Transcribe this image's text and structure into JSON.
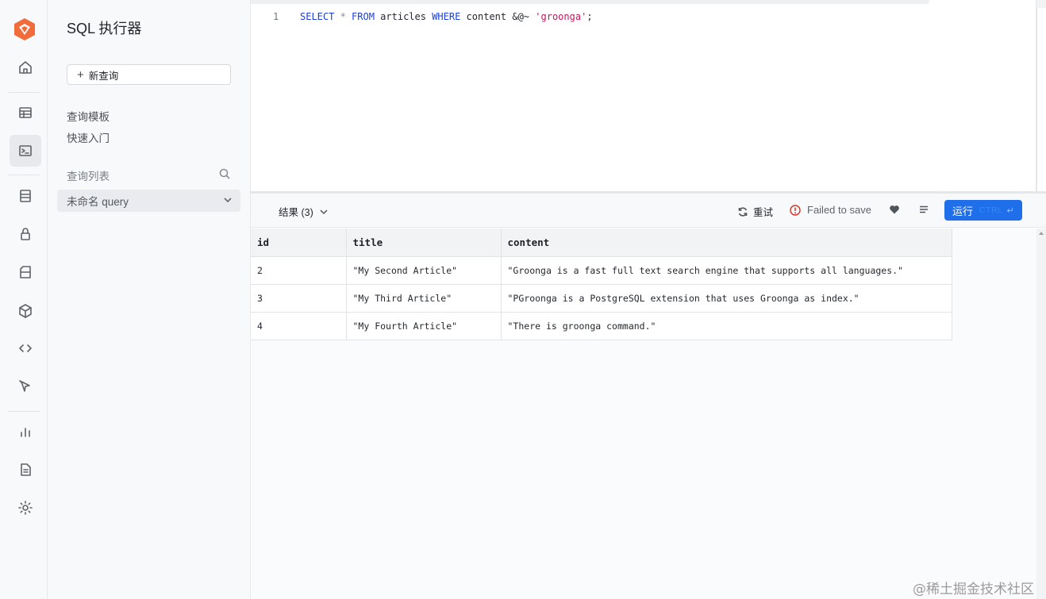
{
  "sidebar": {
    "title": "SQL 执行器",
    "new_query_label": "新查询",
    "links": [
      "查询模板",
      "快速入门"
    ],
    "query_list_label": "查询列表",
    "query_item_label": "未命名 query"
  },
  "editor": {
    "line_number": "1",
    "code_tokens": {
      "t1": "SELECT",
      "t2": " * ",
      "t3": "FROM",
      "t4": " articles ",
      "t5": "WHERE",
      "t6": " content ",
      "t7": "&@~",
      "t8": " ",
      "t9": "'groonga'",
      "t10": ";"
    }
  },
  "results": {
    "results_label": "结果 (3)",
    "retry_label": "重试",
    "status_text": "Failed to save",
    "run_label": "运行",
    "run_shortcut": "CTRL",
    "run_enter": "↵",
    "columns": [
      "id",
      "title",
      "content"
    ],
    "rows": [
      [
        "2",
        "\"My Second Article\"",
        "\"Groonga is a fast full text search engine that supports all languages.\""
      ],
      [
        "3",
        "\"My Third Article\"",
        "\"PGroonga is a PostgreSQL extension that uses Groonga as index.\""
      ],
      [
        "4",
        "\"My Fourth Article\"",
        "\"There is groonga command.\""
      ]
    ]
  },
  "rail_icons": [
    "home-icon",
    "table-icon",
    "terminal-icon",
    "database-icon",
    "lock-icon",
    "storage-icon",
    "cube-icon",
    "code-icon",
    "cursor-icon",
    "chart-icon",
    "document-icon",
    "gear-icon"
  ],
  "watermark": "@稀土掘金技术社区",
  "colors": {
    "accent": "#1f6feb",
    "logo": "#f26b3a",
    "error": "#d93025",
    "string": "#c2185b",
    "keyword": "#1c3fd8"
  }
}
